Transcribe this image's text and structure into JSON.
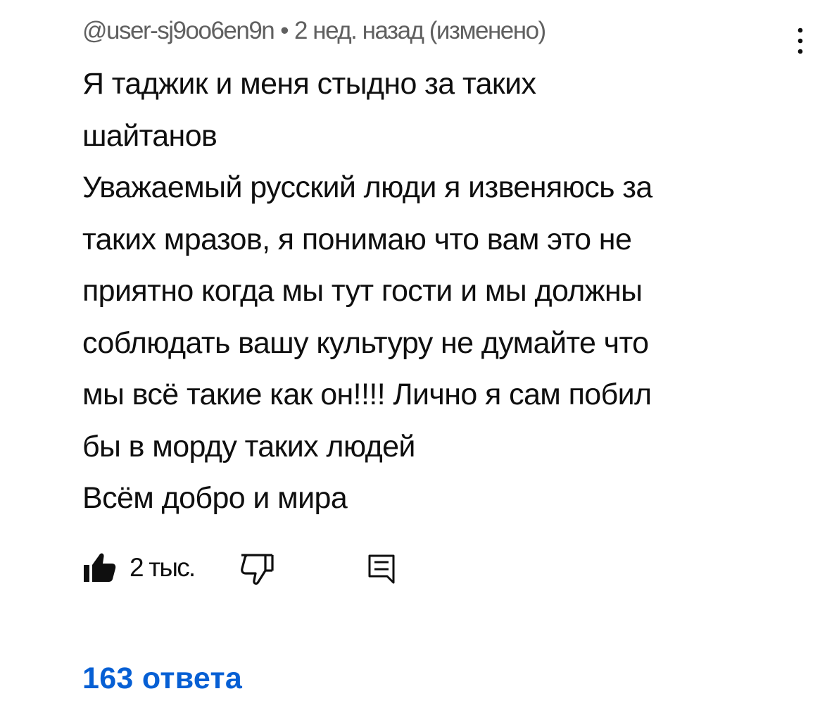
{
  "comment": {
    "author": "@user-sj9oo6en9n",
    "separator": "•",
    "time": "2 нед. назад (изменено)",
    "text": "Я таджик и меня стыдно за таких\nшайтанов\nУважаемый русский люди я извеняюсь за\nтаких мразов, я понимаю что вам это не\nприятно когда мы тут гости и мы должны\nсоблюдать вашу культуру  не думайте что\nмы всё такие как он!!!! Лично я сам побил\nбы в морду таких людей\nВсём добро и мира",
    "like_count": "2 тыс.",
    "replies_label": "163 ответа"
  },
  "icons": {
    "menu": "more-vertical-icon",
    "like": "thumb-up-filled-icon",
    "dislike": "thumb-down-outline-icon",
    "reply": "reply-comment-icon"
  },
  "colors": {
    "text": "#0f0f0f",
    "meta": "#606060",
    "link": "#065fd4",
    "background": "#ffffff"
  }
}
